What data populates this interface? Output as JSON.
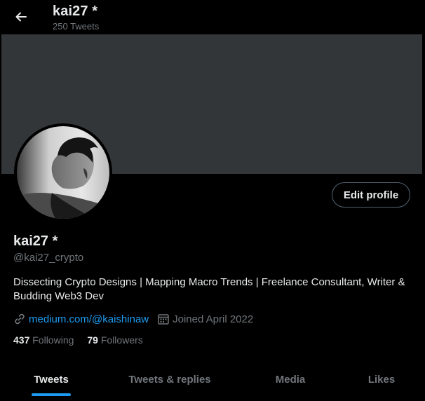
{
  "header": {
    "title": "kai27 *",
    "tweet_count": "250 Tweets"
  },
  "profile": {
    "name": "kai27 *",
    "handle": "@kai27_crypto",
    "bio": "Dissecting Crypto Designs | Mapping Macro Trends | Freelance Consultant, Writer & Budding Web3 Dev",
    "website": "medium.com/@kaishinaw",
    "joined": "Joined April 2022",
    "following_count": "437",
    "following_label": "Following",
    "followers_count": "79",
    "followers_label": "Followers",
    "edit_label": "Edit profile"
  },
  "tabs": [
    {
      "label": "Tweets",
      "active": true
    },
    {
      "label": "Tweets & replies",
      "active": false
    },
    {
      "label": "Media",
      "active": false
    },
    {
      "label": "Likes",
      "active": false
    }
  ],
  "colors": {
    "background": "#000000",
    "banner": "#333639",
    "accent": "#1d9bf0",
    "muted": "#71767b",
    "text": "#e7e9ea"
  }
}
